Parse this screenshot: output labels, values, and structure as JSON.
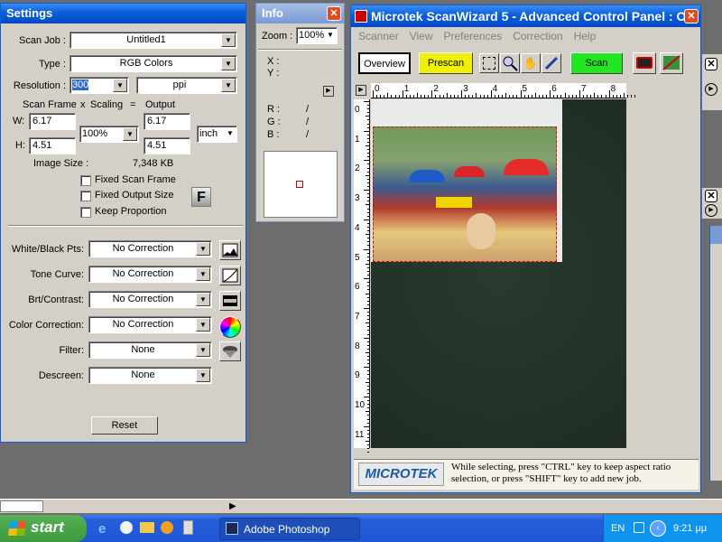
{
  "settings": {
    "title": "Settings",
    "scan_job_label": "Scan Job :",
    "scan_job": "Untitled1",
    "type_label": "Type :",
    "type": "RGB Colors",
    "resolution_label": "Resolution :",
    "resolution": "300",
    "res_unit": "ppi",
    "scan_frame_label": "Scan Frame",
    "x_label": "x",
    "scaling_label": "Scaling",
    "eq_label": "=",
    "output_label": "Output",
    "w_label": "W:",
    "h_label": "H:",
    "w_frame": "6.17",
    "h_frame": "4.51",
    "scaling": "100%",
    "w_out": "6.17",
    "h_out": "4.51",
    "unit": "inch",
    "image_size_label": "Image Size :",
    "image_size": "7,348 KB",
    "fixed_scan_frame": "Fixed Scan Frame",
    "fixed_output_size": "Fixed Output Size",
    "keep_proportion": "Keep Proportion",
    "f_badge": "F",
    "wb_label": "White/Black Pts:",
    "wb": "No Correction",
    "tone_label": "Tone Curve:",
    "tone": "No Correction",
    "brt_label": "Brt/Contrast:",
    "brt": "No Correction",
    "cc_label": "Color Correction:",
    "cc": "No Correction",
    "filter_label": "Filter:",
    "filter": "None",
    "descreen_label": "Descreen:",
    "descreen": "None",
    "reset": "Reset"
  },
  "info": {
    "title": "Info",
    "zoom_label": "Zoom :",
    "zoom": "100%",
    "x_label": "X :",
    "y_label": "Y :",
    "r_label": "R :",
    "g_label": "G :",
    "b_label": "B :",
    "r": "/",
    "g": "/",
    "b": "/"
  },
  "main": {
    "title": "Microtek ScanWizard 5 - Advanced Control Panel : O...",
    "menu": [
      "Scanner",
      "View",
      "Preferences",
      "Correction",
      "Help"
    ],
    "overview": "Overview",
    "prescan": "Prescan",
    "scan": "Scan",
    "ruler_h": [
      "0",
      "1",
      "2",
      "3",
      "4",
      "5",
      "6",
      "7",
      "8"
    ],
    "ruler_v": [
      "0",
      "1",
      "2",
      "3",
      "4",
      "5",
      "6",
      "7",
      "8",
      "9",
      "10",
      "11"
    ],
    "brand": "MICROTEK",
    "hint": "While selecting, press \"CTRL\" key to keep aspect ratio selection, or press \"SHIFT\" key to add new job."
  },
  "taskbar": {
    "start": "start",
    "task": "Adobe Photoshop",
    "lang": "EN",
    "time": "9:21 μμ"
  },
  "colors": {
    "title_blue": "#0a5fd8",
    "prescan_yellow": "#f0f000",
    "scan_green": "#22e622",
    "taskbar_blue": "#245edb",
    "start_green": "#3c9a3c"
  }
}
